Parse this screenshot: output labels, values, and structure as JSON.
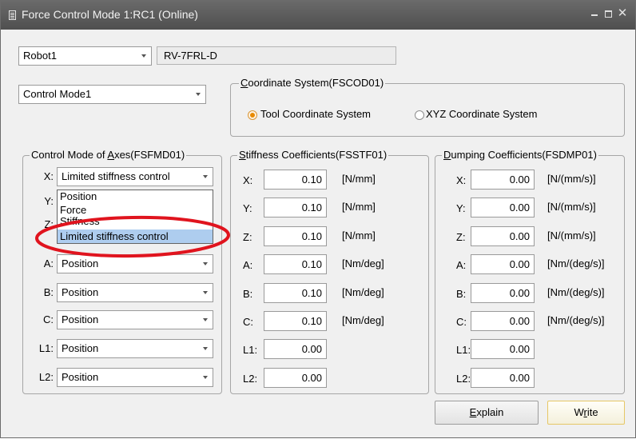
{
  "window": {
    "title": "Force Control Mode 1:RC1  (Online)"
  },
  "robot": {
    "selected": "Robot1",
    "model": "RV-7FRL-D"
  },
  "control_mode": {
    "selected": "Control Mode1"
  },
  "coordinate_system": {
    "legend": "Coordinate System(FSCOD01)",
    "options": [
      {
        "label": "Tool Coordinate System",
        "selected": true
      },
      {
        "label": "XYZ Coordinate System",
        "selected": false
      }
    ]
  },
  "axes_mode": {
    "legend": "Control Mode of Axes(FSFMD01)",
    "rows": [
      {
        "axis": "X:",
        "mode": "Limited stiffness control"
      },
      {
        "axis": "Y:",
        "mode": ""
      },
      {
        "axis": "Z:",
        "mode": ""
      },
      {
        "axis": "A:",
        "mode": "Position"
      },
      {
        "axis": "B:",
        "mode": "Position"
      },
      {
        "axis": "C:",
        "mode": "Position"
      },
      {
        "axis": "L1:",
        "mode": "Position"
      },
      {
        "axis": "L2:",
        "mode": "Position"
      }
    ],
    "dropdown_options": [
      "Position",
      "Force",
      "Stiffness",
      "Limited stiffness control"
    ]
  },
  "stiffness": {
    "legend": "Stiffness Coefficients(FSSTF01)",
    "rows": [
      {
        "axis": "X:",
        "value": "0.10",
        "unit": "[N/mm]"
      },
      {
        "axis": "Y:",
        "value": "0.10",
        "unit": "[N/mm]"
      },
      {
        "axis": "Z:",
        "value": "0.10",
        "unit": "[N/mm]"
      },
      {
        "axis": "A:",
        "value": "0.10",
        "unit": "[Nm/deg]"
      },
      {
        "axis": "B:",
        "value": "0.10",
        "unit": "[Nm/deg]"
      },
      {
        "axis": "C:",
        "value": "0.10",
        "unit": "[Nm/deg]"
      },
      {
        "axis": "L1:",
        "value": "0.00",
        "unit": ""
      },
      {
        "axis": "L2:",
        "value": "0.00",
        "unit": ""
      }
    ]
  },
  "dumping": {
    "legend": "Dumping Coefficients(FSDMP01)",
    "rows": [
      {
        "axis": "X:",
        "value": "0.00",
        "unit": "[N/(mm/s)]"
      },
      {
        "axis": "Y:",
        "value": "0.00",
        "unit": "[N/(mm/s)]"
      },
      {
        "axis": "Z:",
        "value": "0.00",
        "unit": "[N/(mm/s)]"
      },
      {
        "axis": "A:",
        "value": "0.00",
        "unit": "[Nm/(deg/s)]"
      },
      {
        "axis": "B:",
        "value": "0.00",
        "unit": "[Nm/(deg/s)]"
      },
      {
        "axis": "C:",
        "value": "0.00",
        "unit": "[Nm/(deg/s)]"
      },
      {
        "axis": "L1:",
        "value": "0.00",
        "unit": ""
      },
      {
        "axis": "L2:",
        "value": "0.00",
        "unit": ""
      }
    ]
  },
  "buttons": {
    "explain": "Explain",
    "write": "Write"
  },
  "colors": {
    "selection": "#aecdef",
    "annotation": "#e0141e",
    "radio_selected": "#e88a00"
  }
}
